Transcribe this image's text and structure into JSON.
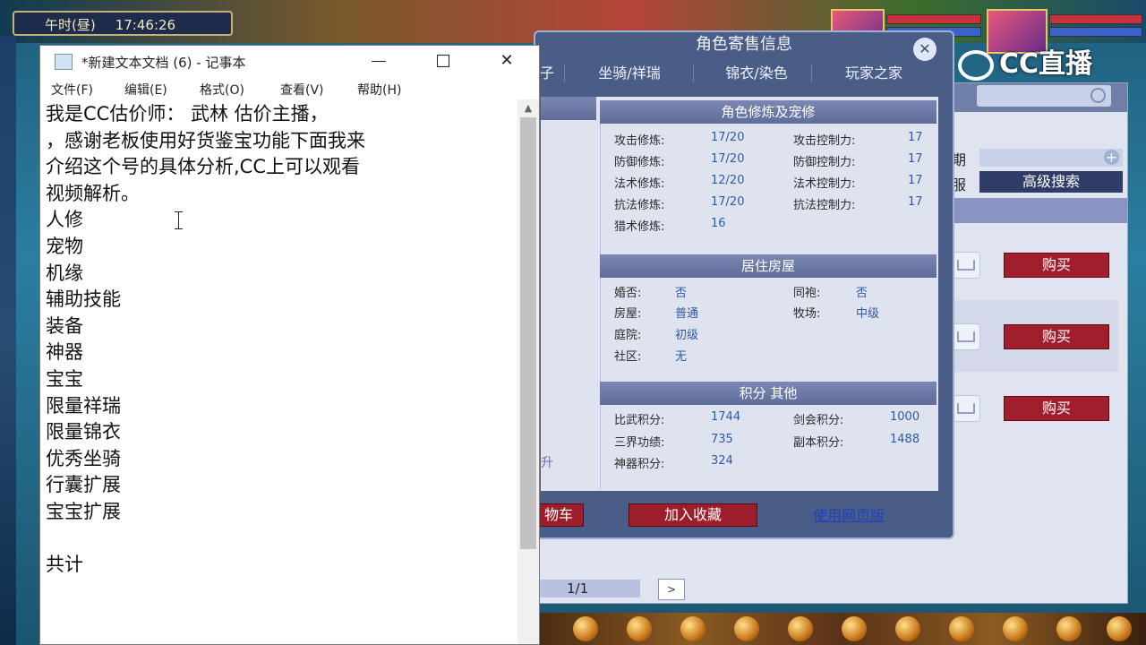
{
  "game": {
    "clock_label": "午时(昼)",
    "clock_time": "17:46:26",
    "cc_logo": "CC直播"
  },
  "search_panel": {
    "period_label": "期",
    "server_label": "服",
    "advanced_search": "高级搜索",
    "buy_label": "购买",
    "pager": "1/1",
    "next_label": ">"
  },
  "role_window": {
    "title": "角色寄售信息",
    "tabs": [
      "子",
      "坐骑/祥瑞",
      "锦衣/染色",
      "玩家之家"
    ],
    "sections": {
      "cultivation": {
        "title": "角色修炼及宠修",
        "rows": [
          {
            "l1": "攻击修炼:",
            "v1": "17/20",
            "l2": "攻击控制力:",
            "v2": "17"
          },
          {
            "l1": "防御修炼:",
            "v1": "17/20",
            "l2": "防御控制力:",
            "v2": "17"
          },
          {
            "l1": "法术修炼:",
            "v1": "12/20",
            "l2": "法术控制力:",
            "v2": "17"
          },
          {
            "l1": "抗法修炼:",
            "v1": "17/20",
            "l2": "抗法控制力:",
            "v2": "17"
          },
          {
            "l1": "猎术修炼:",
            "v1": "16",
            "l2": "",
            "v2": ""
          }
        ]
      },
      "house": {
        "title": "居住房屋",
        "rows": [
          {
            "l1": "婚否:",
            "v1": "否",
            "l2": "同袍:",
            "v2": "否"
          },
          {
            "l1": "房屋:",
            "v1": "普通",
            "l2": "牧场:",
            "v2": "中级"
          },
          {
            "l1": "庭院:",
            "v1": "初级",
            "l2": "",
            "v2": ""
          },
          {
            "l1": "社区:",
            "v1": "无",
            "l2": "",
            "v2": ""
          }
        ]
      },
      "points": {
        "title": "积分 其他",
        "rows": [
          {
            "l1": "比武积分:",
            "v1": "1744",
            "l2": "剑会积分:",
            "v2": "1000"
          },
          {
            "l1": "三界功绩:",
            "v1": "735",
            "l2": "副本积分:",
            "v2": "1488"
          },
          {
            "l1": "神器积分:",
            "v1": "324",
            "l2": "",
            "v2": ""
          }
        ]
      }
    },
    "upgrade_fragment": "升",
    "cart_fragment": "物车",
    "add_favorite": "加入收藏",
    "web_version": "使用网页版"
  },
  "notepad": {
    "title": "*新建文本文档 (6) - 记事本",
    "minimize": "",
    "maximize": "",
    "close": "✕",
    "menu": [
      "文件(F)",
      "编辑(E)",
      "格式(O)",
      "查看(V)",
      "帮助(H)"
    ],
    "lines": [
      "我是CC估价师：  武林 估价主播，",
      "，感谢老板使用好货鉴宝功能下面我来",
      "介绍这个号的具体分析,CC上可以观看",
      "视频解析。",
      "人修",
      "宠物",
      "机缘",
      "辅助技能",
      "装备",
      "神器",
      "宝宝",
      "限量祥瑞",
      "限量锦衣",
      "优秀坐骑",
      "行囊扩展",
      "宝宝扩展",
      "",
      "共计"
    ]
  }
}
